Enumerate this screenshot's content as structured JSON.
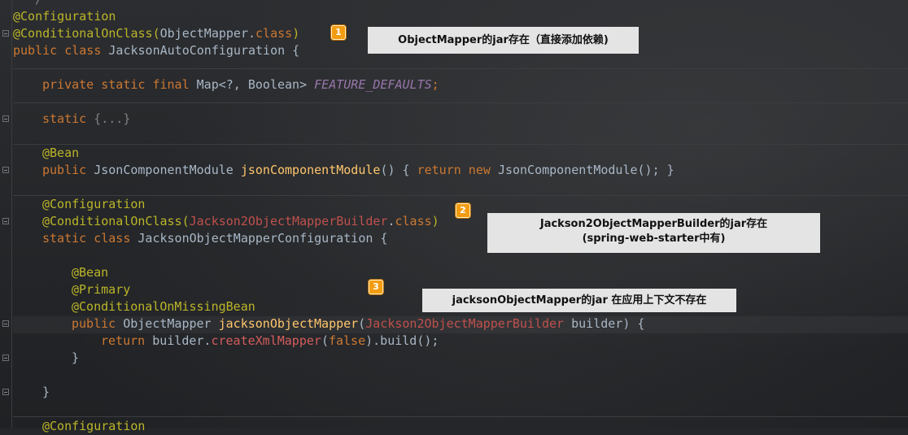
{
  "code": {
    "l0": "  */",
    "l1_ann": "@Configuration",
    "l2_ann": "@ConditionalOnClass(",
    "l2_cls": "ObjectMapper",
    "l2_dot": ".",
    "l2_kw": "class",
    "l2_end": ")",
    "l3_kw": "public class ",
    "l3_name": "JacksonAutoConfiguration {",
    "l4_kw": "private static final ",
    "l4_type": "Map<?, Boolean> ",
    "l4_field": "FEATURE_DEFAULTS",
    "l4_end": ";",
    "l5_kw": "static ",
    "l5_fold": "{...}",
    "l6_ann": "@Bean",
    "l7_kw": "public ",
    "l7_type": "JsonComponentModule ",
    "l7_fn": "jsonComponentModule",
    "l7_mid": "() { ",
    "l7_ret": "return new ",
    "l7_end": "JsonComponentModule(); }",
    "l8_ann": "@Configuration",
    "l9_ann": "@ConditionalOnClass(",
    "l9_cls": "Jackson2ObjectMapperBuilder",
    "l9_dot": ".",
    "l9_kw": "class",
    "l9_end": ")",
    "l10_kw": "static class ",
    "l10_name": "JacksonObjectMapperConfiguration {",
    "l11_ann": "@Bean",
    "l12_ann": "@Primary",
    "l13_ann": "@ConditionalOnMissingBean",
    "l14_kw": "public ",
    "l14_type": "ObjectMapper ",
    "l14_fn": "jacksonObjectMapper",
    "l14_p1": "(",
    "l14_cls": "Jackson2ObjectMapperBuilder",
    "l14_p2": " builder) {",
    "l15_ret": "return ",
    "l15_a": "builder.",
    "l15_call": "createXmlMapper",
    "l15_b": "(",
    "l15_false": "false",
    "l15_c": ").build();",
    "l16": "}",
    "l17": "}",
    "l18_ann": "@Configuration"
  },
  "annotations": [
    {
      "badge": "1",
      "text": "ObjectMapper的jar存在（直接添加依赖)"
    },
    {
      "badge": "2",
      "text_line1": "Jackson2ObjectMapperBuilder的jar存在",
      "text_line2": "(spring-web-starter中有)"
    },
    {
      "badge": "3",
      "text": "jacksonObjectMapper的jar 在应用上下文不存在"
    }
  ],
  "colors": {
    "annotation": "#bbb529",
    "keyword": "#cc7832",
    "method": "#ffc66d",
    "field": "#9876aa",
    "missing_class": "#c0504d",
    "badge": "#f39c12",
    "callout_bg": "#e4e4e4"
  }
}
